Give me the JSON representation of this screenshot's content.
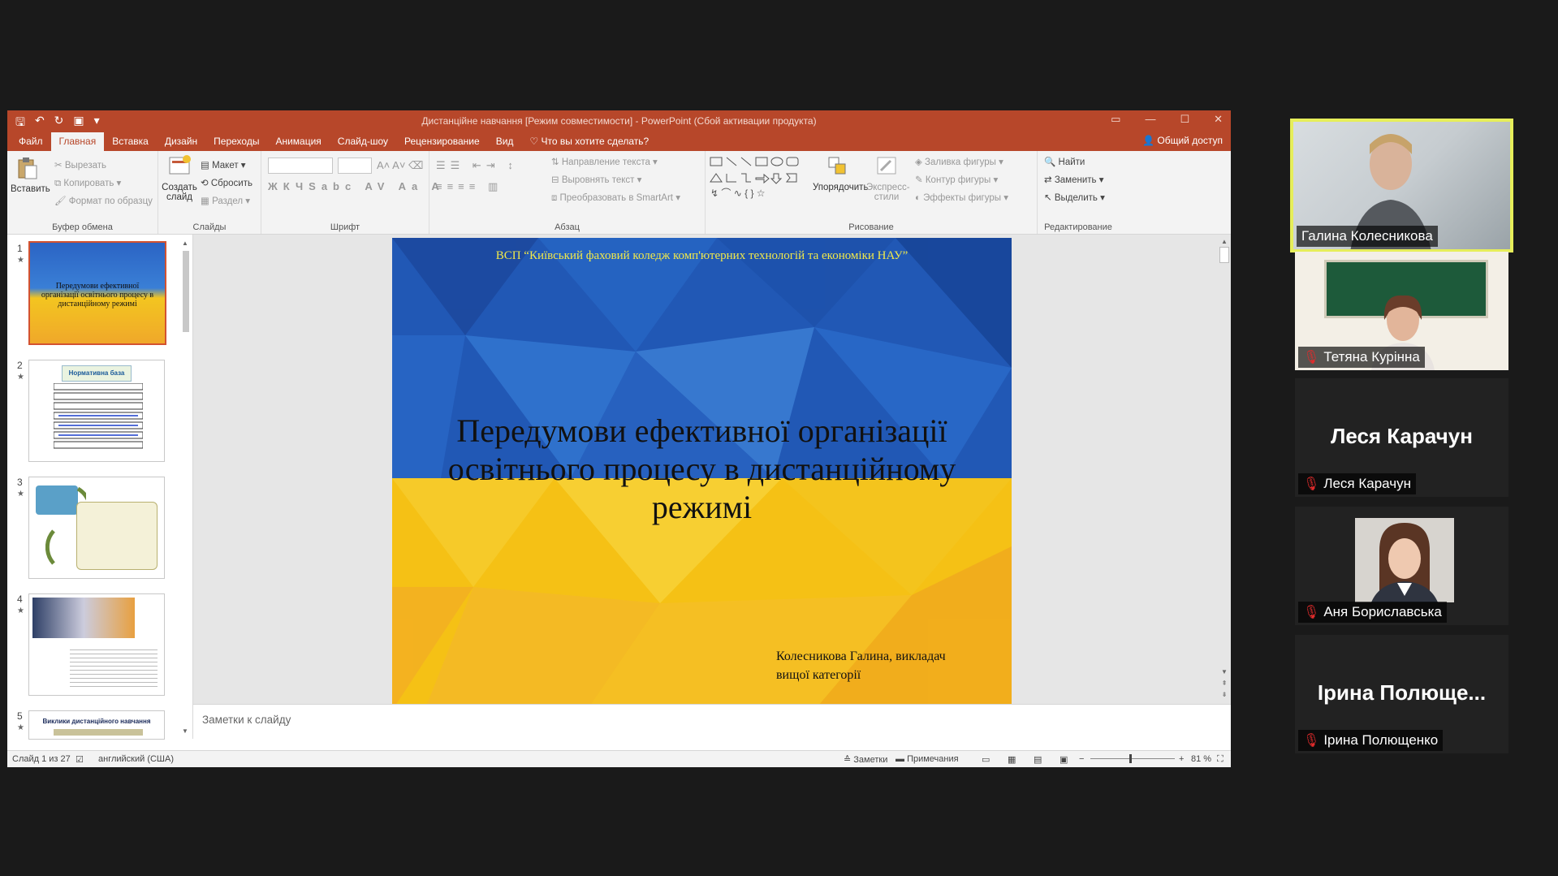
{
  "window": {
    "title": "Дистанційне навчання [Режим совместимости] - PowerPoint (Сбой активации продукта)",
    "share": "Общий доступ"
  },
  "tabs": [
    "Файл",
    "Главная",
    "Вставка",
    "Дизайн",
    "Переходы",
    "Анимация",
    "Слайд-шоу",
    "Рецензирование",
    "Вид"
  ],
  "tell_me": "Что вы хотите сделать?",
  "ribbon": {
    "clipboard": {
      "paste": "Вставить",
      "cut": "Вырезать",
      "copy": "Копировать",
      "format": "Формат по образцу",
      "label": "Буфер обмена"
    },
    "slides": {
      "new": "Создать слайд",
      "layout": "Макет",
      "reset": "Сбросить",
      "section": "Раздел",
      "label": "Слайды"
    },
    "font": {
      "label": "Шрифт"
    },
    "paragraph": {
      "direction": "Направление текста",
      "align": "Выровнять текст",
      "smartart": "Преобразовать в SmartArt",
      "label": "Абзац"
    },
    "drawing": {
      "arrange": "Упорядочить",
      "styles": "Экспресс-стили",
      "fill": "Заливка фигуры",
      "outline": "Контур фигуры",
      "effects": "Эффекты фигуры",
      "label": "Рисование"
    },
    "editing": {
      "find": "Найти",
      "replace": "Заменить",
      "select": "Выделить",
      "label": "Редактирование"
    }
  },
  "thumbnails": {
    "numbers": [
      "1",
      "2",
      "3",
      "4",
      "5"
    ],
    "t1_title": "Передумови ефективної організації освітнього процесу в дистанційному режимі",
    "t2_title": "Нормативна база",
    "t5_title": "Виклики дистанційного навчання"
  },
  "slide": {
    "header": "ВСП “Київський фаховий коледж комп'ютерних технологій та економіки НАУ”",
    "title": "Передумови ефективної організації освітнього процесу в дистанційному режимі",
    "author": "Колесникова Галина, викладач вищої категорії"
  },
  "notes_placeholder": "Заметки к слайду",
  "status": {
    "slide": "Слайд 1 из 27",
    "language": "английский (США)",
    "notes": "Заметки",
    "comments": "Примечания",
    "zoom": "81 %"
  },
  "participants": [
    {
      "name": "Галина Колесникова",
      "muted": false,
      "video": true,
      "active": true
    },
    {
      "name": "Тетяна Курінна",
      "muted": true,
      "video": true
    },
    {
      "name": "Леся Карачун",
      "big": "Леся Карачун",
      "muted": true,
      "video": false
    },
    {
      "name": "Аня Бориславська",
      "muted": true,
      "video": true
    },
    {
      "name": "Ірина Полющенко",
      "big": "Ірина  Полюще...",
      "muted": true,
      "video": false
    }
  ],
  "colors": {
    "accent": "#b7472a",
    "flag_blue": "#1f5bb8",
    "flag_yellow": "#f5c515",
    "active_speaker": "#e6ee5a"
  }
}
